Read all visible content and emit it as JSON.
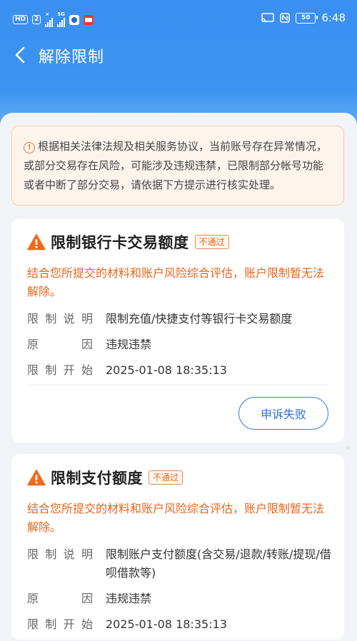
{
  "status_bar": {
    "left_badges": [
      "HD",
      "2"
    ],
    "signal_mini_1": "×",
    "signal_mini_2": "5G",
    "right_battery": "50",
    "time": "6:48"
  },
  "nav": {
    "title": "解除限制"
  },
  "notice": {
    "text": "根据相关法律法规及相关服务协议，当前账号存在异常情况，或部分交易存在风险，可能涉及违规违禁，已限制部分帐号功能或者中断了部分交易，请依据下方提示进行核实处理。"
  },
  "cards": [
    {
      "title": "限制银行卡交易额度",
      "badge": "不通过",
      "warning": "结合您所提交的材料和账户风险综合评估，账户限制暂无法解除。",
      "rows": [
        {
          "key": [
            "限",
            "制",
            "说",
            "明"
          ],
          "value": "限制充值/快捷支付等银行卡交易额度"
        },
        {
          "key": [
            "原",
            "因"
          ],
          "value": "违规违禁"
        },
        {
          "key": [
            "限",
            "制",
            "开",
            "始"
          ],
          "value": "2025-01-08 18:35:13"
        }
      ],
      "button": "申诉失败"
    },
    {
      "title": "限制支付额度",
      "badge": "不通过",
      "warning": "结合您所提交的材料和账户风险综合评估，账户限制暂无法解除。",
      "rows": [
        {
          "key": [
            "限",
            "制",
            "说",
            "明"
          ],
          "value": "限制账户支付额度(含交易/退款/转账/提现/借呗借款等)"
        },
        {
          "key": [
            "原",
            "因"
          ],
          "value": "违规违禁"
        },
        {
          "key": [
            "限",
            "制",
            "开",
            "始"
          ],
          "value": "2025-01-08 18:35:13"
        }
      ]
    }
  ],
  "colors": {
    "header_blue": "#3a8ff0",
    "warning_orange": "#e6661e",
    "button_blue": "#2d6fd6"
  },
  "icons": [
    "back-arrow-icon",
    "info-circle-icon",
    "warning-triangle-icon",
    "wifi-icon",
    "nfc-icon",
    "battery-icon"
  ]
}
